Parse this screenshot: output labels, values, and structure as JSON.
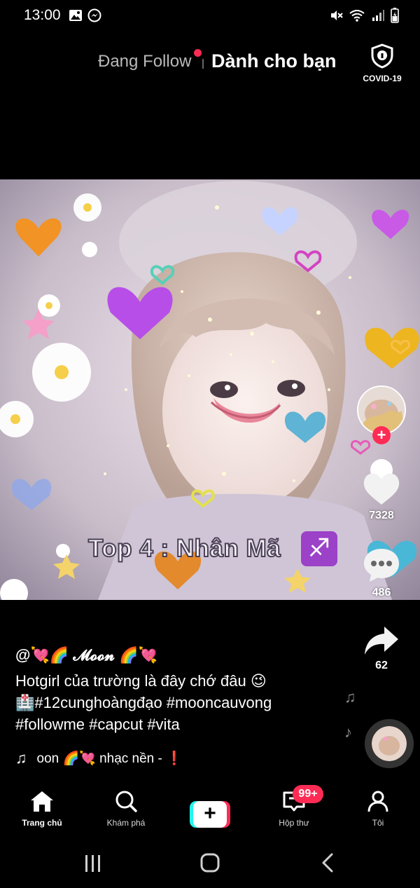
{
  "status_bar": {
    "time": "13:00",
    "left_icons": [
      "gallery-icon",
      "messenger-icon"
    ],
    "right_icons": [
      "mute-icon",
      "wifi-icon",
      "signal-icon",
      "battery-icon"
    ]
  },
  "top_tabs": {
    "following_label": "Đang Follow",
    "for_you_label": "Dành cho bạn",
    "covid_label": "COVID-19"
  },
  "video": {
    "overlay_text": "Top 4 : Nhân Mã",
    "zodiac_symbol": "♐"
  },
  "rail": {
    "like_count": "7328",
    "comment_count": "486",
    "share_count": "62"
  },
  "post": {
    "author": "@💘🌈 𝓜𝓸𝓸𝓷 🌈💘",
    "line1": "Hotgirl của trường là đây chớ đâu 😉",
    "line2": "🏥#12cunghoàngđạo #mooncauvong",
    "line3": "#followme #capcut #vita"
  },
  "music": {
    "note": "♫",
    "text": "oon 🌈💘     nhạc nền - ❗"
  },
  "bottom_nav": {
    "home": "Trang chủ",
    "discover": "Khám phá",
    "create": "+",
    "inbox": "Hộp thư",
    "inbox_badge": "99+",
    "profile": "Tôi"
  },
  "colors": {
    "accent": "#fe2c55",
    "cyan": "#25f4ee",
    "background": "#000000"
  }
}
